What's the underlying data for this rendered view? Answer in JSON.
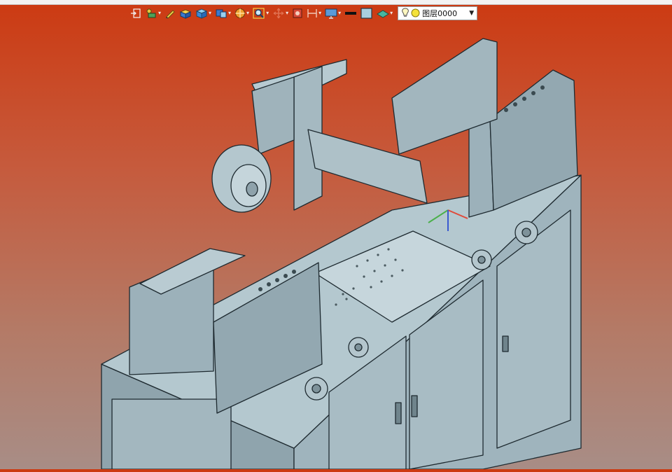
{
  "toolbar": {
    "layer_label": "图层0000",
    "dropdown_caret": "▾",
    "select_caret": "▼"
  },
  "colors": {
    "background_top": "#cc3a12",
    "background_bottom": "#a88d86",
    "model_fill": "#a7bcc4",
    "model_stroke": "#1e2a30"
  },
  "icons": [
    "insert-icon",
    "component-icon",
    "pen-icon",
    "box-stack-icon",
    "cube-icon",
    "view-cube-icon",
    "render-icon",
    "zoom-fit-icon",
    "move-icon",
    "section-icon",
    "frame-icon",
    "display-icon",
    "line-style-icon",
    "color-fill-icon",
    "layer-visible-icon",
    "layer-color-icon"
  ]
}
